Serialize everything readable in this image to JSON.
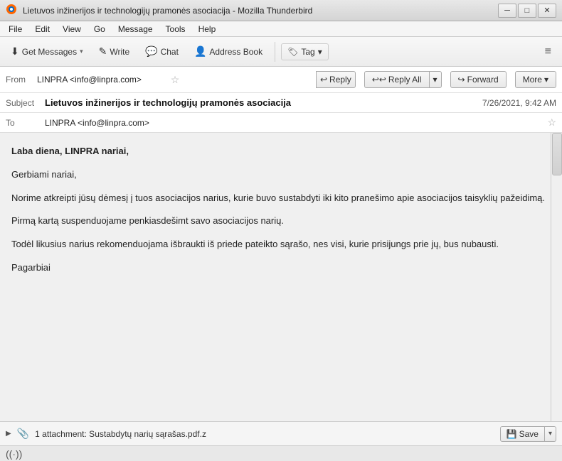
{
  "titleBar": {
    "title": "Lietuvos inžinerijos ir technologijų pramonės asociacija - Mozilla Thunderbird",
    "minBtn": "─",
    "maxBtn": "□",
    "closeBtn": "✕"
  },
  "menuBar": {
    "items": [
      "File",
      "Edit",
      "View",
      "Go",
      "Message",
      "Tools",
      "Help"
    ]
  },
  "toolbar": {
    "getMessages": "Get Messages",
    "write": "Write",
    "chat": "Chat",
    "addressBook": "Address Book",
    "tag": "Tag",
    "hamburger": "≡"
  },
  "emailActions": {
    "reply": "Reply",
    "replyAll": "Reply All",
    "forward": "Forward",
    "more": "More"
  },
  "emailHeader": {
    "fromLabel": "From",
    "fromValue": "LINPRA <info@linpra.com>",
    "subjectLabel": "Subject",
    "subjectValue": "Lietuvos inžinerijos ir technologijų pramonės asociacija",
    "date": "7/26/2021, 9:42 AM",
    "toLabel": "To",
    "toValue": "LINPRA <info@linpra.com>"
  },
  "emailBody": {
    "greeting": "Laba diena, LINPRA nariai,",
    "salutation": "Gerbiami nariai,",
    "para1": "Norime atkreipti jūsų dėmesį į tuos asociacijos narius, kurie buvo sustabdyti iki kito pranešimo apie asociacijos taisyklių pažeidimą.",
    "para2": "Pirmą kartą suspenduojame penkiasdešimt savo asociacijos narių.",
    "para3": "Todėl likusius narius rekomenduojama išbraukti iš priede pateikto sąrašo, nes visi, kurie prisijungs prie jų, bus nubausti.",
    "closing": "Pagarbiai"
  },
  "attachment": {
    "count": "1 attachment: Sustabdytų narių sąrašas.pdf.z",
    "saveLabel": "Save"
  },
  "statusBar": {
    "icon": "((·))",
    "text": ""
  },
  "icons": {
    "star": "☆",
    "replyIcon": "↩",
    "replyAllIcon": "↩↩",
    "forwardIcon": "↪",
    "dropdownArrow": "▾",
    "getMessagesIcon": "⬇",
    "writeIcon": "✎",
    "chatIcon": "💬",
    "addressBookIcon": "👤",
    "tagIcon": "🏷",
    "clipIcon": "📎",
    "saveIcon": "💾",
    "expandArrow": "▶"
  }
}
